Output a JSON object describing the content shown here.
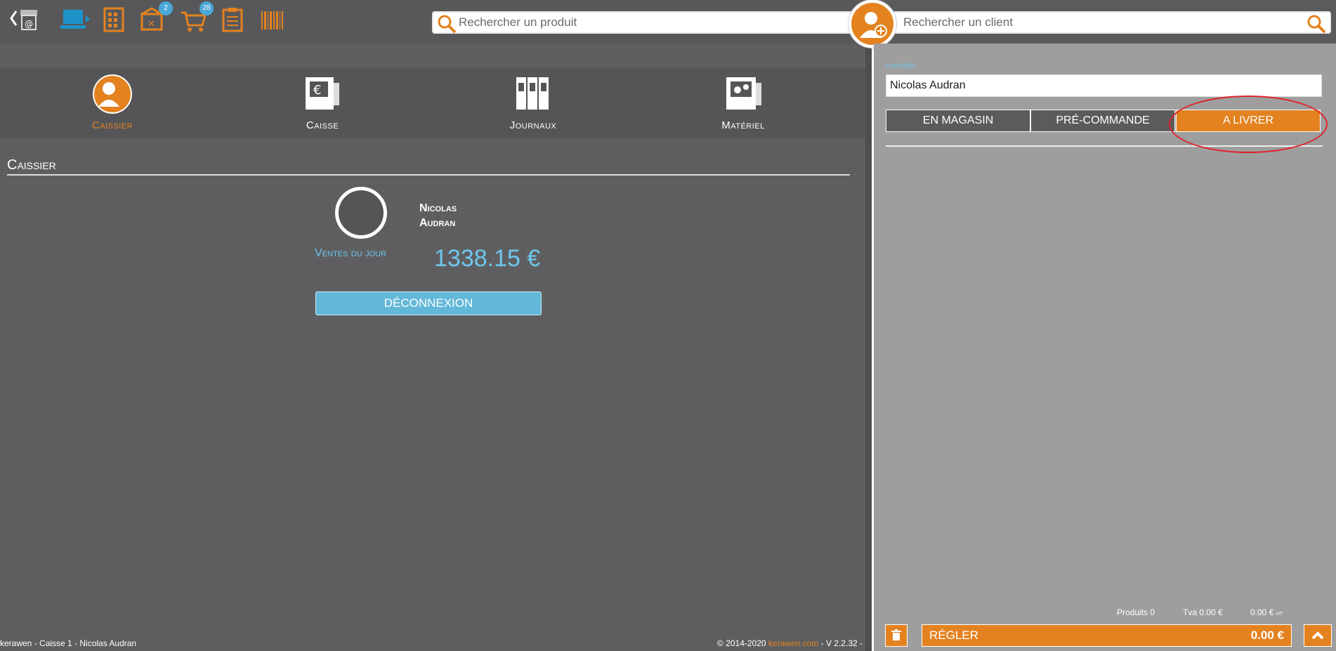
{
  "toolbar": {
    "badges": {
      "orders": "2",
      "carts": "28"
    }
  },
  "search": {
    "product_placeholder": "Rechercher un produit",
    "client_placeholder": "Rechercher un client"
  },
  "nav": {
    "items": [
      {
        "label": "Caissier"
      },
      {
        "label": "Caisse"
      },
      {
        "label": "Journaux"
      },
      {
        "label": "Matériel"
      }
    ]
  },
  "section": {
    "title": "Caissier"
  },
  "cashier": {
    "first_name": "Nicolas",
    "last_name": "Audran",
    "sales_label": "Ventes du jour",
    "sales_value": "1338.15 €",
    "logout_label": "DÉCONNEXION"
  },
  "footer": {
    "left": "kerawen - Caisse 1 - Nicolas Audran",
    "copyright": "© 2014-2020 ",
    "link": "kerawen.com",
    "version": " - V 2.2.32 -"
  },
  "cart": {
    "cashier_label": "CAISSIER",
    "cashier_name": "Nicolas Audran",
    "modes": [
      "EN MAGASIN",
      "PRÉ-COMMANDE",
      "A LIVRER"
    ],
    "active_mode": "A LIVRER",
    "products": "Produits 0",
    "tva": "Tva 0.00 €",
    "total_ht": "0.00 €",
    "ht_suffix": "HT",
    "pay_label": "RÉGLER",
    "pay_amount": "0.00 €"
  },
  "colors": {
    "accent": "#e3821f",
    "info": "#6ec6ee",
    "highlight_circle": "#e0242a"
  }
}
